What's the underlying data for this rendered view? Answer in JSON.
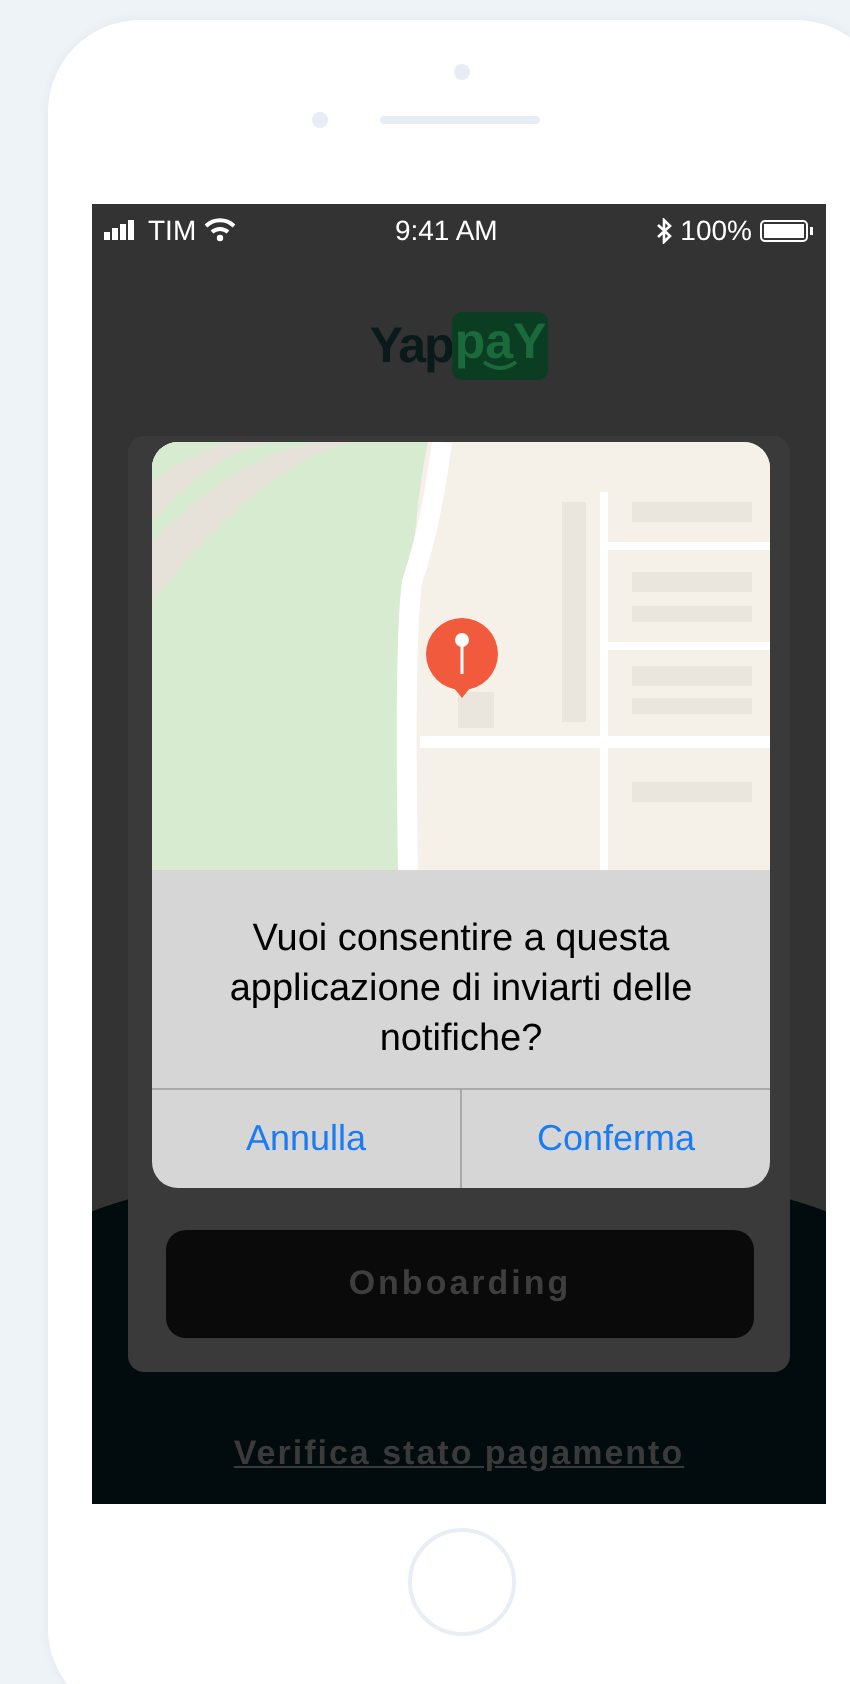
{
  "status_bar": {
    "carrier": "TIM",
    "time": "9:41 AM",
    "battery": "100%"
  },
  "logo": {
    "text_left": "Yap",
    "text_right": "paY"
  },
  "onboarding_button": {
    "label": "Onboarding"
  },
  "link": {
    "label": "Verifica stato pagamento"
  },
  "alert": {
    "message": "Vuoi consentire a questa applicazione di inviarti delle notifiche?",
    "buttons": [
      {
        "label": "Annulla"
      },
      {
        "label": "Conferma"
      }
    ]
  }
}
